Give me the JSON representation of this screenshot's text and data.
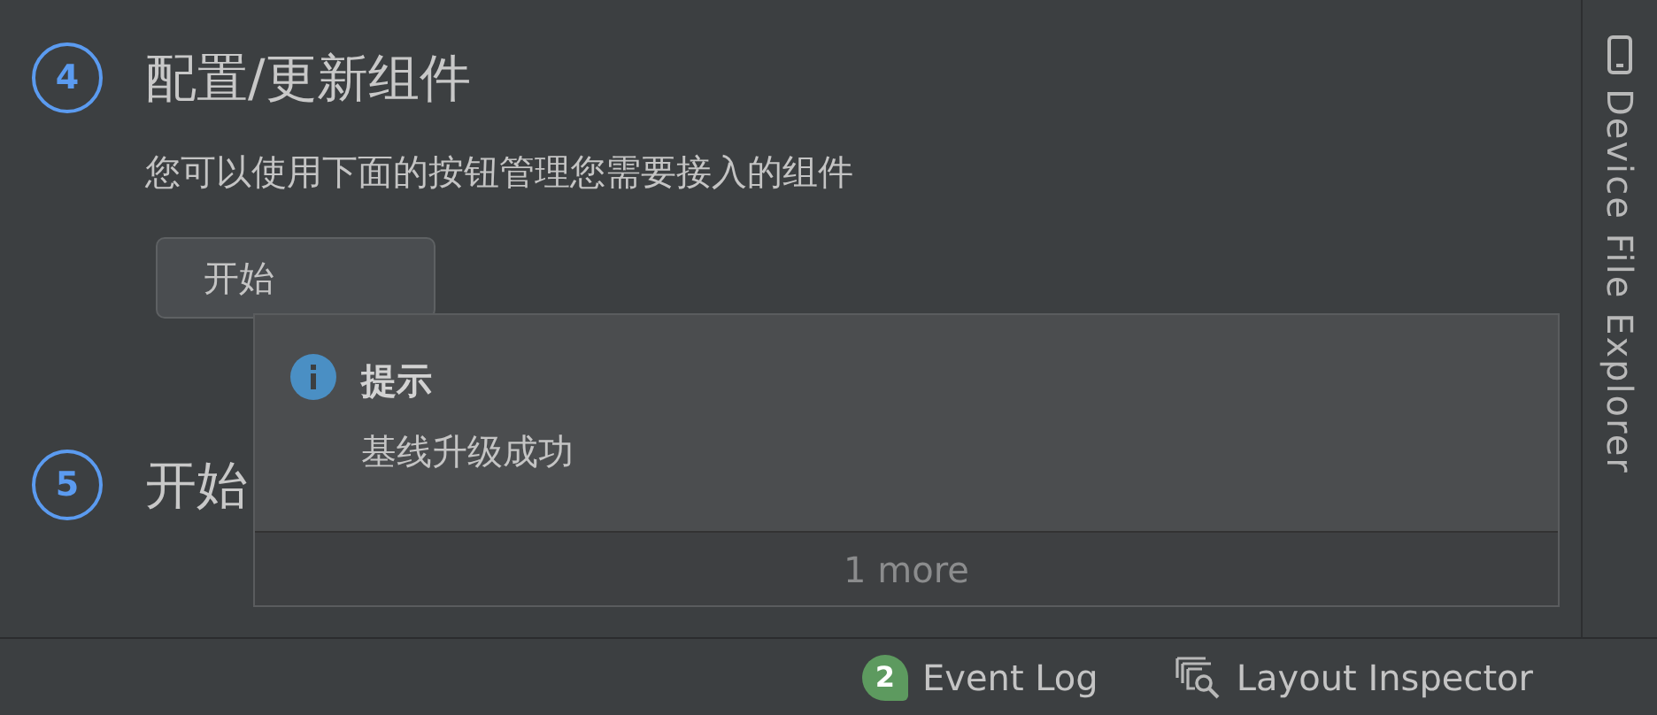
{
  "steps": [
    {
      "number": "4",
      "title": "配置/更新组件",
      "description": "您可以使用下面的按钮管理您需要接入的组件",
      "button": "开始"
    },
    {
      "number": "5",
      "title": "开始"
    }
  ],
  "notification": {
    "kind": "info",
    "title": "提示",
    "message": "基线升级成功",
    "more": "1 more"
  },
  "side_tool": {
    "label": "Device File Explorer"
  },
  "status_bar": [
    {
      "kind": "event-log",
      "badge": "2",
      "label": "Event Log"
    },
    {
      "kind": "layout-inspector",
      "label": "Layout Inspector"
    }
  ]
}
